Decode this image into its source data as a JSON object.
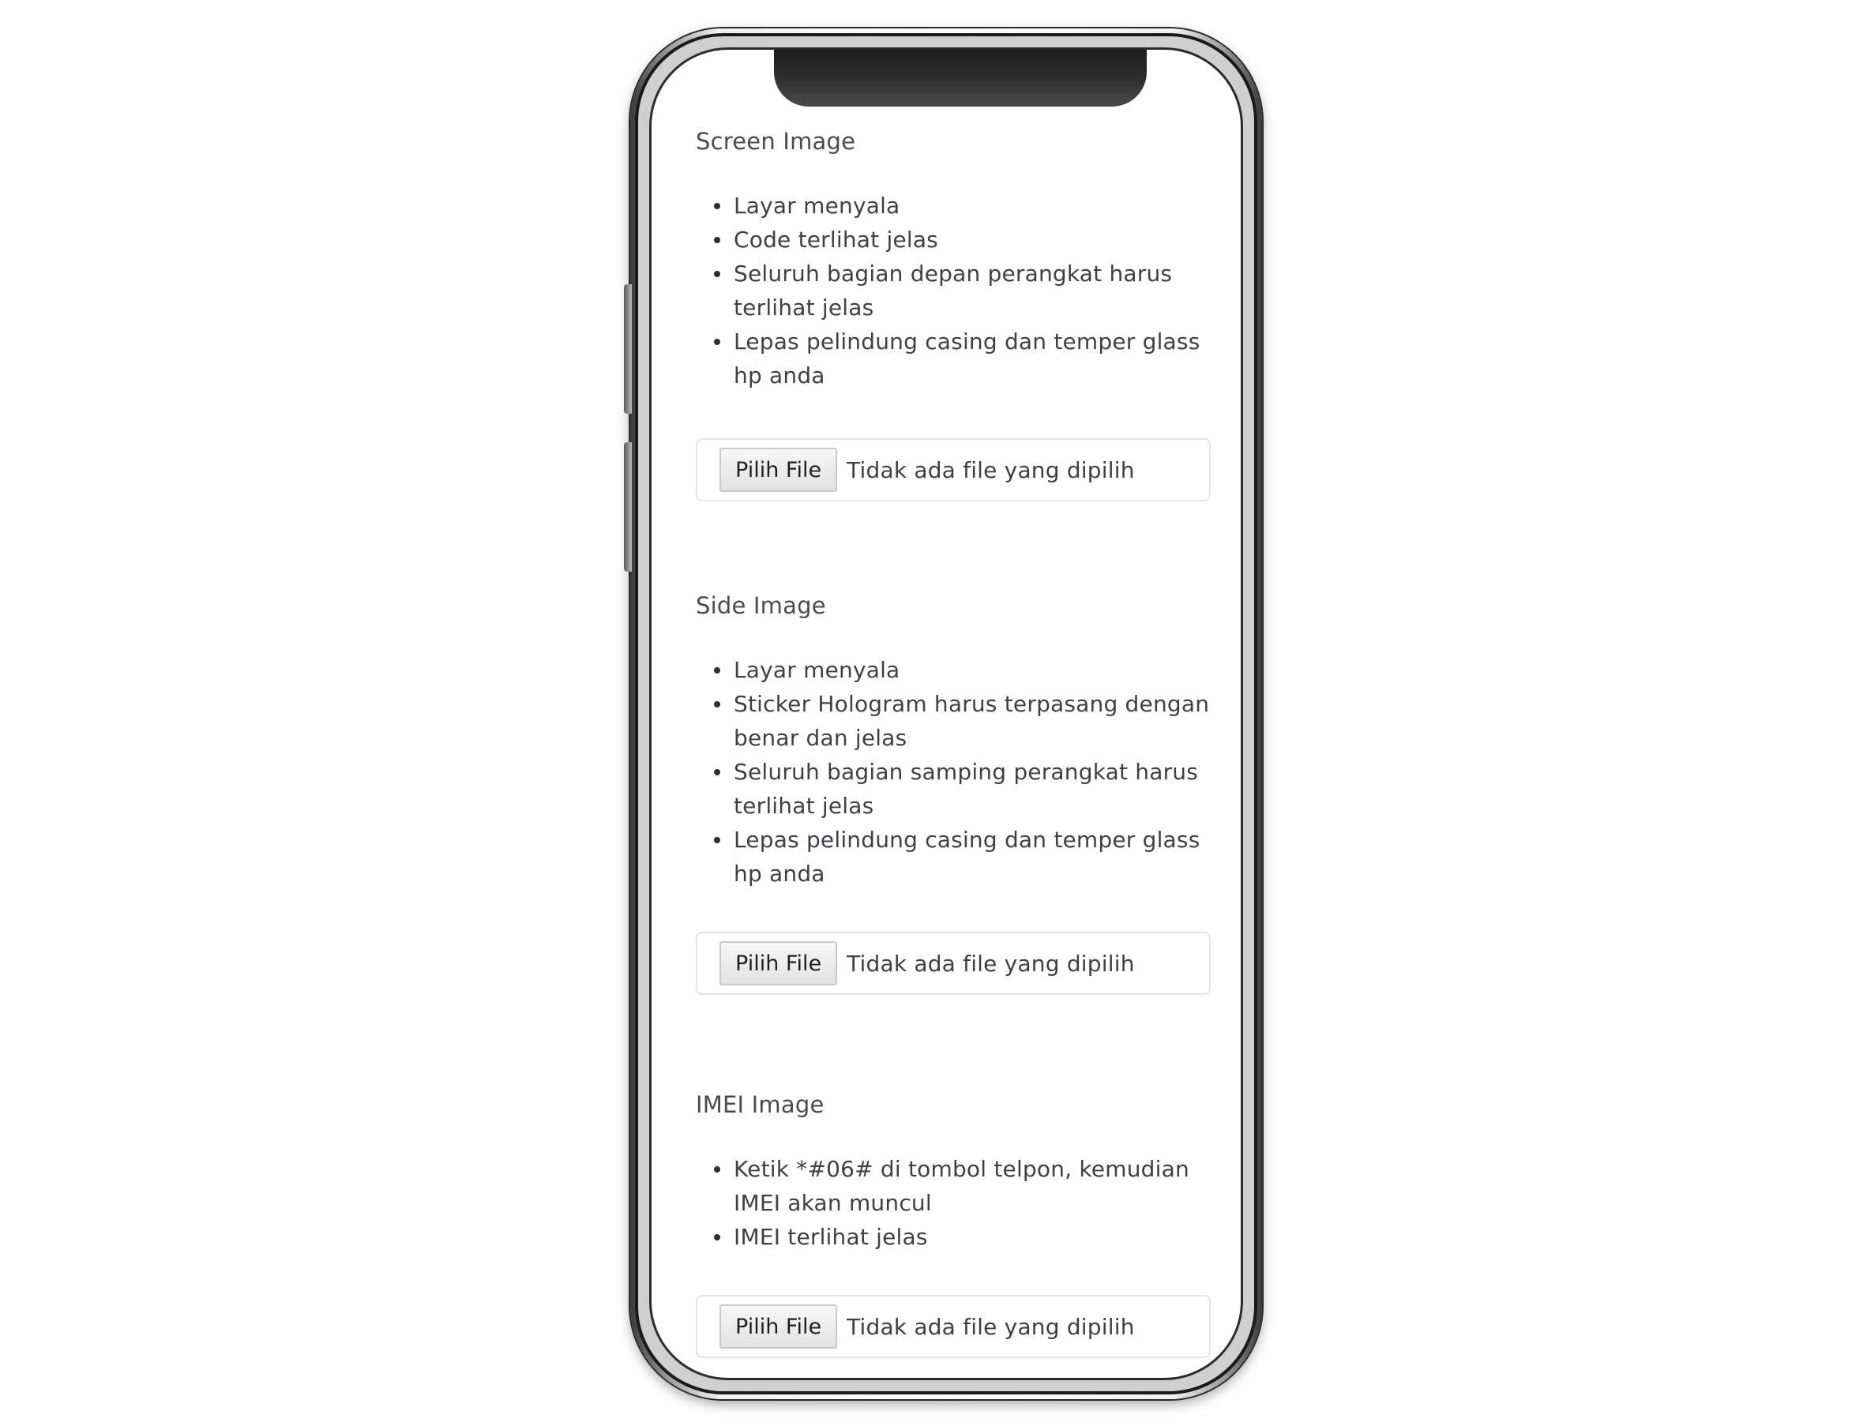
{
  "sections": [
    {
      "title": "Screen Image",
      "rules": [
        "Layar menyala",
        "Code terlihat jelas",
        "Seluruh bagian depan perangkat harus terlihat jelas",
        "Lepas pelindung casing dan temper glass hp anda"
      ],
      "file_button": "Pilih File",
      "file_status": "Tidak ada file yang dipilih"
    },
    {
      "title": "Side Image",
      "rules": [
        "Layar menyala",
        "Sticker Hologram harus terpasang dengan benar dan jelas",
        "Seluruh bagian samping perangkat harus terlihat jelas",
        "Lepas pelindung casing dan temper glass hp anda"
      ],
      "file_button": "Pilih File",
      "file_status": "Tidak ada file yang dipilih"
    },
    {
      "title": "IMEI Image",
      "rules": [
        "Ketik *#06# di tombol telpon, kemudian IMEI akan muncul",
        "IMEI terlihat jelas"
      ],
      "file_button": "Pilih File",
      "file_status": "Tidak ada file yang dipilih"
    }
  ]
}
